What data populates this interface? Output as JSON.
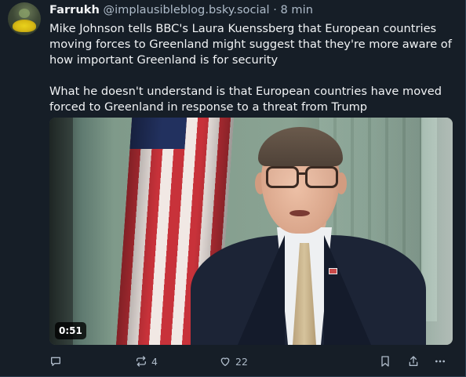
{
  "post": {
    "author": {
      "display_name": "Farrukh",
      "handle": "@implausibleblog.bsky.social",
      "separator": "·",
      "time": "8 min"
    },
    "text": {
      "paragraph1": "Mike Johnson tells BBC's Laura Kuenssberg that European countries moving forces to Greenland might suggest that they're more aware of how important Greenland is for security",
      "paragraph2": "What he doesn't understand is that European countries have moved forced to Greenland in response to a threat from Trump"
    },
    "video": {
      "duration": "0:51"
    },
    "actions": {
      "reply_icon": "speech-bubble-icon",
      "repost_icon": "repost-arrows-icon",
      "repost_count": "4",
      "like_icon": "heart-icon",
      "like_count": "22",
      "bookmark_icon": "bookmark-icon",
      "share_icon": "share-icon",
      "more_icon": "ellipsis-icon"
    }
  },
  "colors": {
    "background": "#161e27",
    "text_primary": "#f1f3f5",
    "text_secondary": "#aebbc9"
  }
}
